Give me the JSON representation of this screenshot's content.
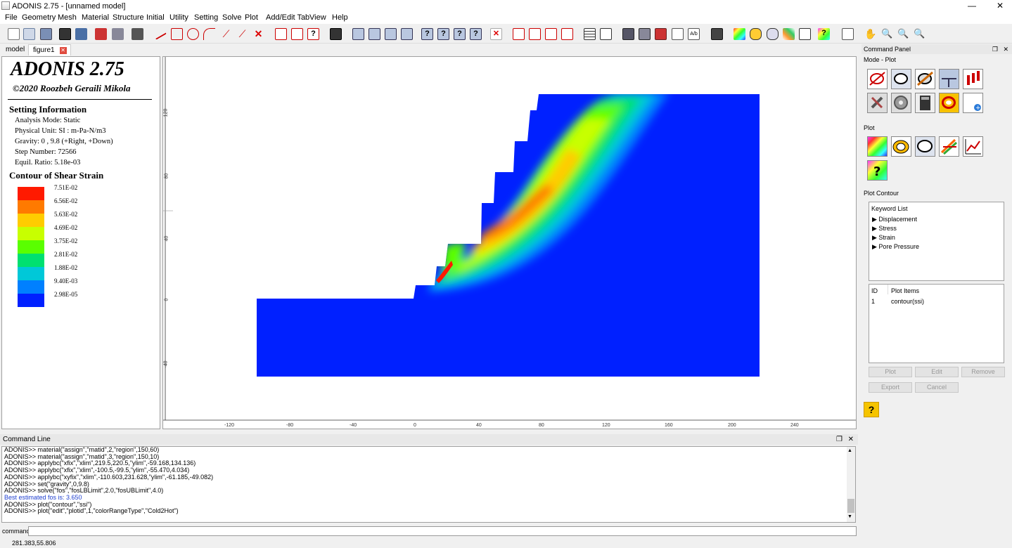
{
  "window": {
    "title": "ADONIS 2.75 - [unnamed model]",
    "minimize": "—",
    "restore": "❐",
    "close": "✕"
  },
  "menu": [
    "File",
    "Geometry",
    "Mesh",
    "Material",
    "Structure",
    "Initial",
    "Utility",
    "Setting",
    "Solve",
    "Plot",
    "Add/Edit Tab",
    "View",
    "Help"
  ],
  "tabs": {
    "model": "model",
    "figure": "figure1"
  },
  "info": {
    "app_name": "ADONIS 2.75",
    "copyright": "©2020 Roozbeh Geraili Mikola",
    "setting_header": "Setting Information",
    "analysis_mode": "Analysis Mode: Static",
    "physical_unit": "Physical Unit: SI : m-Pa-N/m3",
    "gravity": "Gravity: 0 , 9.8 (+Right, +Down)",
    "step_number": "Step Number: 72566",
    "equil_ratio": "Equil. Ratio: 5.18e-03",
    "contour_header": "Contour of Shear Strain"
  },
  "legend": [
    {
      "label": "7.51E-02",
      "color": "#ff1a00"
    },
    {
      "label": "6.56E-02",
      "color": "#ff7a00"
    },
    {
      "label": "5.63E-02",
      "color": "#ffcc00"
    },
    {
      "label": "4.69E-02",
      "color": "#c8ff00"
    },
    {
      "label": "3.75E-02",
      "color": "#5aff00"
    },
    {
      "label": "2.81E-02",
      "color": "#00e070"
    },
    {
      "label": "1.88E-02",
      "color": "#00c8d8"
    },
    {
      "label": "9.40E-03",
      "color": "#0080ff"
    },
    {
      "label": "2.98E-05",
      "color": "#0020ff"
    }
  ],
  "plot_axes": {
    "x_ticks": [
      "-120",
      "-80",
      "-40",
      "0",
      "40",
      "80",
      "120",
      "160",
      "200",
      "240"
    ],
    "y_ticks": [
      "120",
      "80",
      "40",
      "0",
      "-40"
    ]
  },
  "command_line": {
    "header": "Command Line",
    "lines": [
      {
        "text": "ADONIS>> material(\"assign\",\"matid\",2,\"region\",150,60)",
        "kind": "cmd"
      },
      {
        "text": "ADONIS>> material(\"assign\",\"matid\",3,\"region\",150,10)",
        "kind": "cmd"
      },
      {
        "text": "ADONIS>> applybc(\"xfix\",\"xlim\",219.5,220.5,\"ylim\",-59.168,134.136)",
        "kind": "cmd"
      },
      {
        "text": "ADONIS>> applybc(\"xfix\",\"xlim\",-100.5,-99.5,\"ylim\",-55.470,4.034)",
        "kind": "cmd"
      },
      {
        "text": "ADONIS>> applybc(\"xyfix\",\"xlim\",-110.603,231.628,\"ylim\",-61.185,-49.082)",
        "kind": "cmd"
      },
      {
        "text": "ADONIS>> set(\"gravity\",0,9.8)",
        "kind": "cmd"
      },
      {
        "text": "ADONIS>> solve(\"fos\",\"fosLBLimit\",2.0,\"fosUBLimit\",4.0)",
        "kind": "cmd"
      },
      {
        "text": "Best estimated fos is: 3.650",
        "kind": "result"
      },
      {
        "text": "ADONIS>> plot(\"contour\",\"ssi\")",
        "kind": "cmd"
      },
      {
        "text": "ADONIS>> plot(\"edit\",\"plotid\",1,\"colorRangeType\",\"Cold2Hot\")",
        "kind": "cmd"
      }
    ],
    "input_label": "command",
    "input_value": ""
  },
  "status": {
    "coords": "281.383,55.806"
  },
  "command_panel": {
    "header": "Command Panel",
    "mode_label": "Mode - Plot",
    "plot_label": "Plot",
    "plot_contour_label": "Plot Contour",
    "keyword_list_label": "Keyword List",
    "keywords": [
      "Displacement",
      "Stress",
      "Strain",
      "Pore Pressure"
    ],
    "items_header": {
      "id": "ID",
      "name": "Plot Items"
    },
    "items": [
      {
        "id": "1",
        "name": "contour(ssi)"
      }
    ],
    "buttons": {
      "plot": "Plot",
      "edit": "Edit",
      "remove": "Remove",
      "export": "Export",
      "cancel": "Cancel"
    },
    "help": "?"
  }
}
